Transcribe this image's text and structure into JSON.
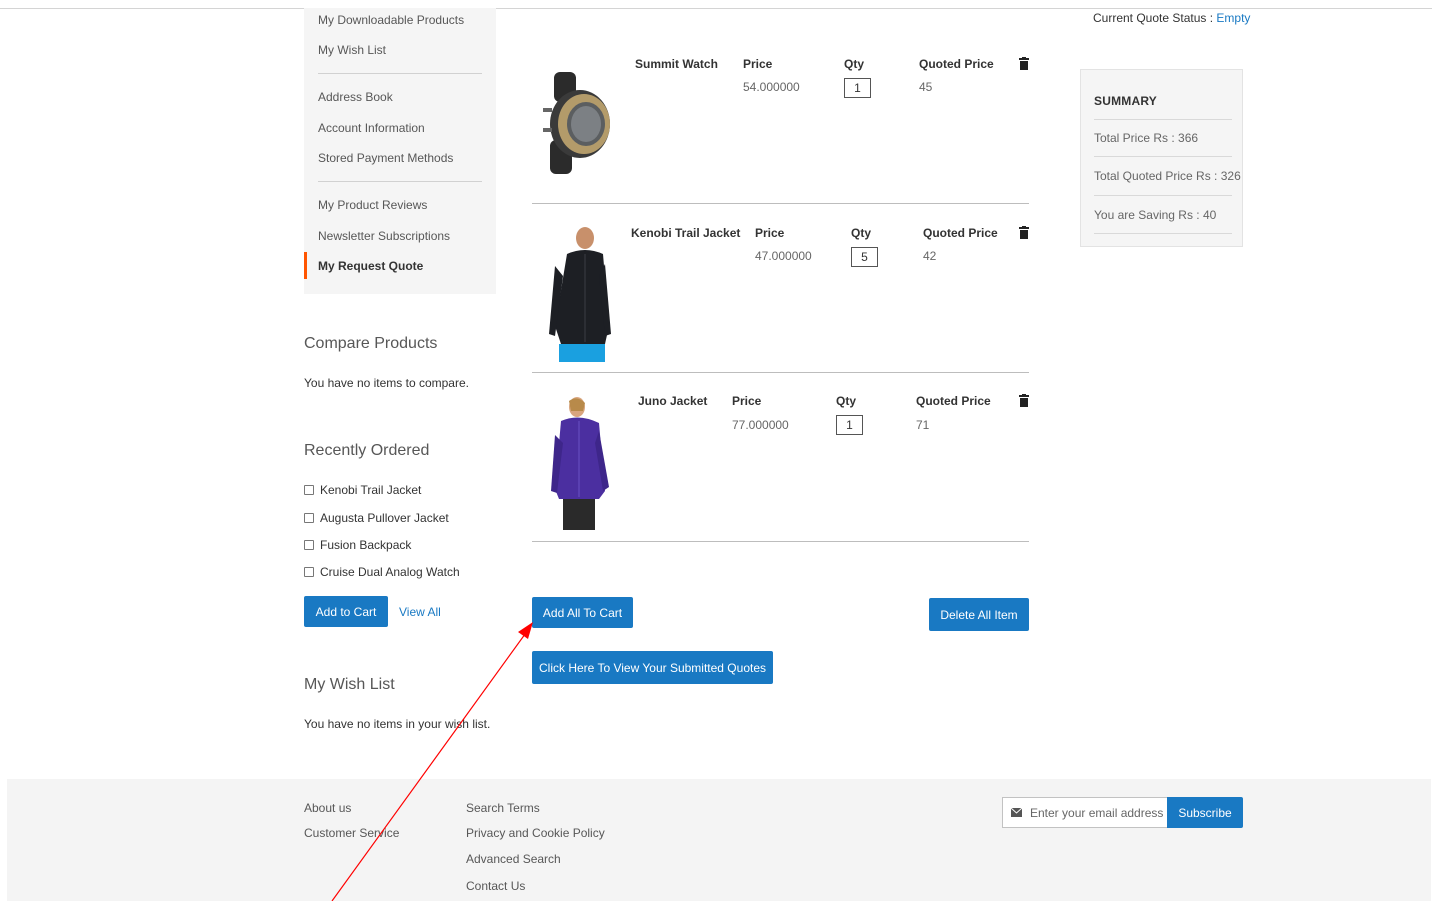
{
  "account_nav": {
    "items": [
      {
        "label": "My Downloadable Products"
      },
      {
        "label": "My Wish List"
      },
      {
        "label": "Address Book"
      },
      {
        "label": "Account Information"
      },
      {
        "label": "Stored Payment Methods"
      },
      {
        "label": "My Product Reviews"
      },
      {
        "label": "Newsletter Subscriptions"
      },
      {
        "label": "My Request Quote"
      }
    ]
  },
  "compare": {
    "title": "Compare Products",
    "empty_text": "You have no items to compare."
  },
  "recently_ordered": {
    "title": "Recently Ordered",
    "items": [
      {
        "label": "Kenobi Trail Jacket"
      },
      {
        "label": "Augusta Pullover Jacket"
      },
      {
        "label": "Fusion Backpack"
      },
      {
        "label": "Cruise Dual Analog Watch"
      }
    ],
    "add_to_cart_label": "Add to Cart",
    "view_all_label": "View All"
  },
  "wishlist": {
    "title": "My Wish List",
    "empty_text": "You have no items in your wish list."
  },
  "quote_items": [
    {
      "name": "Summit Watch",
      "price_label": "Price",
      "price": "54.000000",
      "qty_label": "Qty",
      "qty": "1",
      "quoted_label": "Quoted Price",
      "quoted": "45",
      "image_icon": "watch-image"
    },
    {
      "name": "Kenobi Trail Jacket",
      "price_label": "Price",
      "price": "47.000000",
      "qty_label": "Qty",
      "qty": "5",
      "quoted_label": "Quoted Price",
      "quoted": "42",
      "image_icon": "jacket-image"
    },
    {
      "name": "Juno Jacket",
      "price_label": "Price",
      "price": "77.000000",
      "qty_label": "Qty",
      "qty": "1",
      "quoted_label": "Quoted Price",
      "quoted": "71",
      "image_icon": "jacket-image"
    }
  ],
  "actions": {
    "add_all_to_cart": "Add All To Cart",
    "delete_all": "Delete All Item",
    "view_submitted": "Click Here To View Your Submitted Quotes"
  },
  "quote_status": {
    "label": "Current Quote Status :",
    "value": "Empty"
  },
  "summary": {
    "title": "SUMMARY",
    "total_price": "Total Price Rs : 366",
    "total_quoted": "Total Quoted Price Rs : 326",
    "saving": "You are Saving Rs : 40"
  },
  "footer": {
    "col1": [
      {
        "label": "About us"
      },
      {
        "label": "Customer Service"
      }
    ],
    "col2": [
      {
        "label": "Search Terms"
      },
      {
        "label": "Privacy and Cookie Policy"
      },
      {
        "label": "Advanced Search"
      },
      {
        "label": "Contact Us"
      }
    ],
    "newsletter_placeholder": "Enter your email address",
    "subscribe_label": "Subscribe"
  },
  "colors": {
    "accent": "#1979c3",
    "active_marker": "#ff5501",
    "annotation_arrow": "#ff0000"
  }
}
